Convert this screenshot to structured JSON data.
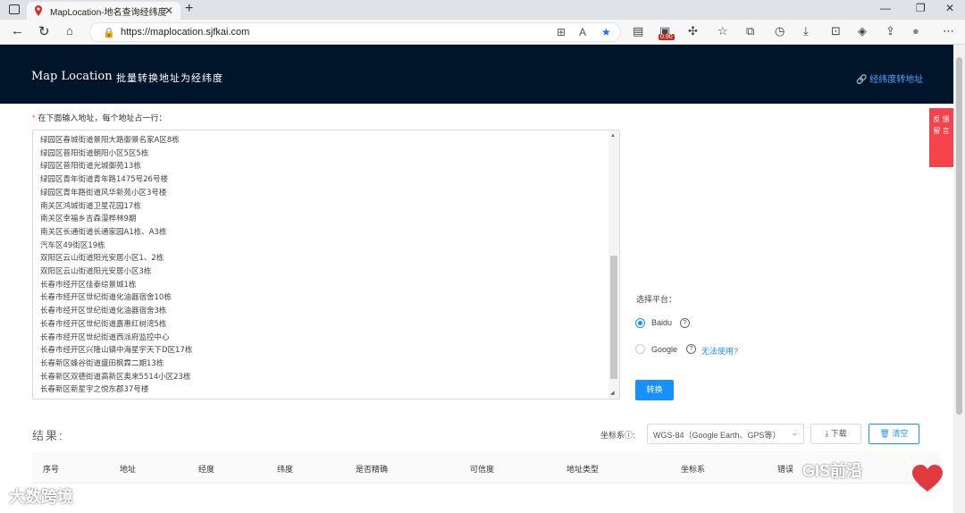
{
  "browser": {
    "tab_title": "MapLocation-地名查询经纬度|批",
    "tab_close": "✕",
    "new_tab": "+",
    "url": "https://maplocation.sjfkai.com",
    "extension_badge": "0.90",
    "window_buttons": [
      "—",
      "❐",
      "✕"
    ]
  },
  "header": {
    "brand": "Map Location",
    "subtitle": "批量转换地址为经纬度",
    "right_link": "经纬度转地址"
  },
  "feedback": {
    "label": "反 馈 留 言"
  },
  "input": {
    "label": "在下面输入地址，每个地址占一行：",
    "lines": [
      "绿园区春城街道景阳大路御景名家A区8栋",
      "绿园区普阳街道朝阳小区5区5栋",
      "绿园区普阳街道光城御苑13栋",
      "绿园区青年街道青年路1475号26号楼",
      "绿园区青年路街道风华新苑小区3号楼",
      "南关区鸿城街道卫星花园17栋",
      "南关区幸福乡吉森漫桦林9期",
      "南关区长通街道长通家园A1栋、A3栋",
      "汽车区49街区19栋",
      "双阳区云山街道阳光安居小区1、2栋",
      "双阳区云山街道阳光安居小区3栋",
      "长春市经开区佳泰综景城1栋",
      "长春市经开区世纪街道化油器宿舍10栋",
      "长春市经开区世纪街道化油器宿舍3栋",
      "长春市经开区世纪街道嘉惠红树湾5栋",
      "长春市经开区世纪街道西派府监控中心",
      "长春市经开区兴隆山镇中海星宇天下D区17栋",
      "长春新区蜂谷街道盛田枫霖二期13栋",
      "长春新区双德街道高新区奥来5514小区23栋",
      "长春新区新星宇之悦东郡37号楼"
    ]
  },
  "platform": {
    "label": "选择平台：",
    "options": [
      {
        "label": "Baidu",
        "selected": true
      },
      {
        "label": "Google",
        "selected": false
      }
    ],
    "unavailable_link": "无法使用?",
    "convert_button": "转换"
  },
  "result": {
    "title": "结果:",
    "crs_label": "坐标系",
    "crs_value": "WGS-84（Google Earth、GPS等）",
    "download_button": "下载",
    "clear_button": "清空",
    "columns": [
      "序号",
      "地址",
      "经度",
      "纬度",
      "是否精确",
      "可信度",
      "地址类型",
      "坐标系",
      "错误"
    ]
  },
  "watermarks": {
    "left": "大数跨境",
    "right": "GIS前沿"
  },
  "colors": {
    "header_bg": "#001529",
    "accent": "#1890ff",
    "feedback_bg": "#f5424b"
  }
}
